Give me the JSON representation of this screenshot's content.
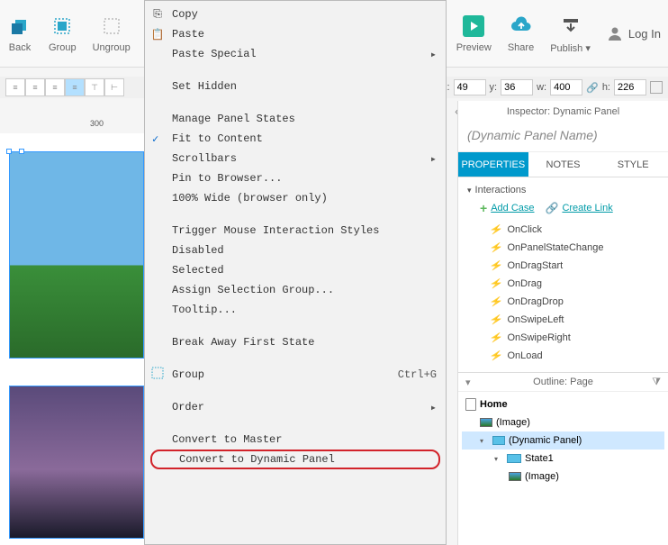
{
  "toolbar": {
    "back": "Back",
    "group": "Group",
    "ungroup": "Ungroup",
    "preview": "Preview",
    "share": "Share",
    "publish": "Publish ▾",
    "login": "Log In"
  },
  "position": {
    "x_label": "x:",
    "x": "49",
    "y_label": "y:",
    "y": "36",
    "w_label": "w:",
    "w": "400",
    "h_label": "h:",
    "h": "226"
  },
  "ruler": {
    "tick300": "300"
  },
  "context_menu": {
    "copy": "Copy",
    "paste": "Paste",
    "paste_special": "Paste Special",
    "set_hidden": "Set Hidden",
    "manage_panel_states": "Manage Panel States",
    "fit_to_content": "Fit to Content",
    "scrollbars": "Scrollbars",
    "pin_to_browser": "Pin to Browser...",
    "hundred_wide": "100% Wide (browser only)",
    "trigger_mouse": "Trigger Mouse Interaction Styles",
    "disabled": "Disabled",
    "selected": "Selected",
    "assign_selection_group": "Assign Selection Group...",
    "tooltip": "Tooltip...",
    "break_away": "Break Away First State",
    "group_item": "Group",
    "group_shortcut": "Ctrl+G",
    "order": "Order",
    "convert_master": "Convert to Master",
    "convert_dynamic": "Convert to Dynamic Panel"
  },
  "inspector": {
    "title": "Inspector: Dynamic Panel",
    "name_placeholder": "(Dynamic Panel Name)",
    "tabs": {
      "properties": "PROPERTIES",
      "notes": "NOTES",
      "style": "STYLE"
    },
    "interactions_label": "Interactions",
    "add_case": "Add Case",
    "create_link": "Create Link",
    "events": {
      "onclick": "OnClick",
      "onpanelstatechange": "OnPanelStateChange",
      "ondragstart": "OnDragStart",
      "ondrag": "OnDrag",
      "ondragdrop": "OnDragDrop",
      "onswipeleft": "OnSwipeLeft",
      "onswiperight": "OnSwipeRight",
      "onload": "OnLoad"
    }
  },
  "outline": {
    "title": "Outline: Page",
    "home": "Home",
    "image1": "(Image)",
    "dynamic_panel": "(Dynamic Panel)",
    "state1": "State1",
    "image2": "(Image)"
  }
}
